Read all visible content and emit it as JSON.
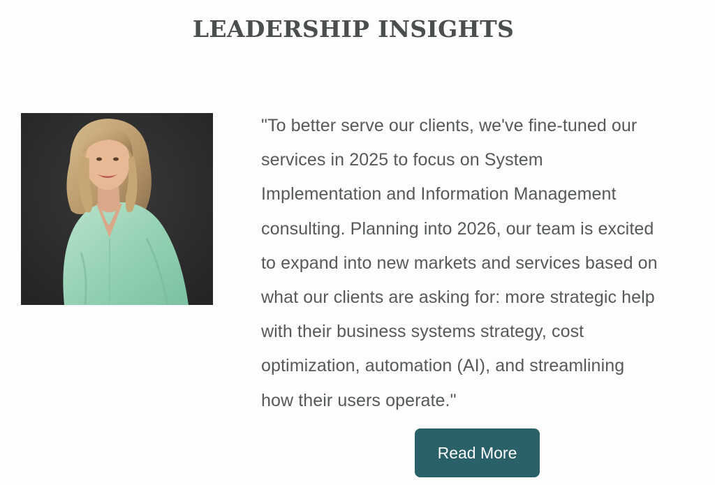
{
  "section": {
    "title": "LEADERSHIP INSIGHTS"
  },
  "quote": {
    "lines": [
      "\"To better serve our clients, we've fine-tuned our",
      "services in 2025 to focus on System",
      "Implementation and Information Management",
      "consulting. Planning into 2026, our team is excited",
      "to expand into new markets and services based on",
      "what our clients are asking for: more strategic help",
      "with their business systems strategy, cost",
      "optimization, automation (AI), and streamlining",
      "how their users operate.\""
    ]
  },
  "cta": {
    "label": "Read More"
  },
  "colors": {
    "button_bg": "#2a6068",
    "title": "#4a4f4d",
    "body_text": "#555a57"
  }
}
